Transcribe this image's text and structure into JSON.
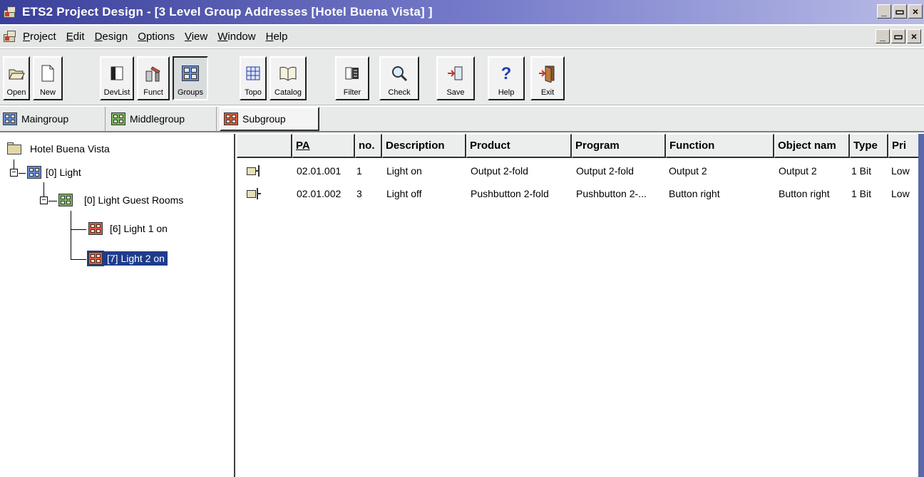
{
  "window": {
    "title": "ETS2 Project Design - [3 Level Group Addresses [Hotel Buena Vista] ]",
    "buttons": [
      "_",
      "ř",
      "×"
    ]
  },
  "menu": {
    "items": [
      {
        "label": "Project",
        "u": "P",
        "rest": "roject"
      },
      {
        "label": "Edit",
        "u": "E",
        "rest": "dit"
      },
      {
        "label": "Design",
        "u": "D",
        "rest": "esign"
      },
      {
        "label": "Options",
        "u": "O",
        "rest": "ptions"
      },
      {
        "label": "View",
        "u": "V",
        "rest": "iew"
      },
      {
        "label": "Window",
        "u": "W",
        "rest": "indow"
      },
      {
        "label": "Help",
        "u": "H",
        "rest": "elp"
      }
    ]
  },
  "toolbar": {
    "open": "Open",
    "new": "New",
    "devlist": "DevList",
    "funct": "Funct",
    "groups": "Groups",
    "topo": "Topo",
    "catalog": "Catalog",
    "filter": "Filter",
    "check": "Check",
    "save": "Save",
    "help": "Help",
    "exit": "Exit"
  },
  "groupbar": {
    "maingroup": "Maingroup",
    "middlegroup": "Middlegroup",
    "subgroup": "Subgroup"
  },
  "tree": {
    "root": "Hotel Buena Vista",
    "main": "[0] Light",
    "middle": "[0] Light Guest Rooms",
    "sub1": "[6] Light 1 on",
    "sub2": "[7] Light 2 on"
  },
  "table": {
    "headers": {
      "pa": "PA",
      "no": "no.",
      "description": "Description",
      "product": "Product",
      "program": "Program",
      "function": "Function",
      "object": "Object nam",
      "type": "Type",
      "priority": "Pri"
    },
    "rows": [
      {
        "pa": "02.01.001",
        "no": "1",
        "description": "Light on",
        "product": "Output 2-fold",
        "program": "Output 2-fold",
        "function": "Output 2",
        "object": "Output 2",
        "type": "1 Bit",
        "priority": "Low"
      },
      {
        "pa": "02.01.002",
        "no": "3",
        "description": "Light off",
        "product": "Pushbutton 2-fold",
        "program": "Pushbutton 2-...",
        "function": "Button right",
        "object": "Button right",
        "type": "1 Bit",
        "priority": "Low"
      }
    ]
  },
  "colors": {
    "titlebar": "#3a3f9a",
    "selection": "#1e3c8c",
    "maingroup": "#6a8fd8",
    "middlegroup": "#7cb85a",
    "subgroup": "#e05a3a"
  }
}
